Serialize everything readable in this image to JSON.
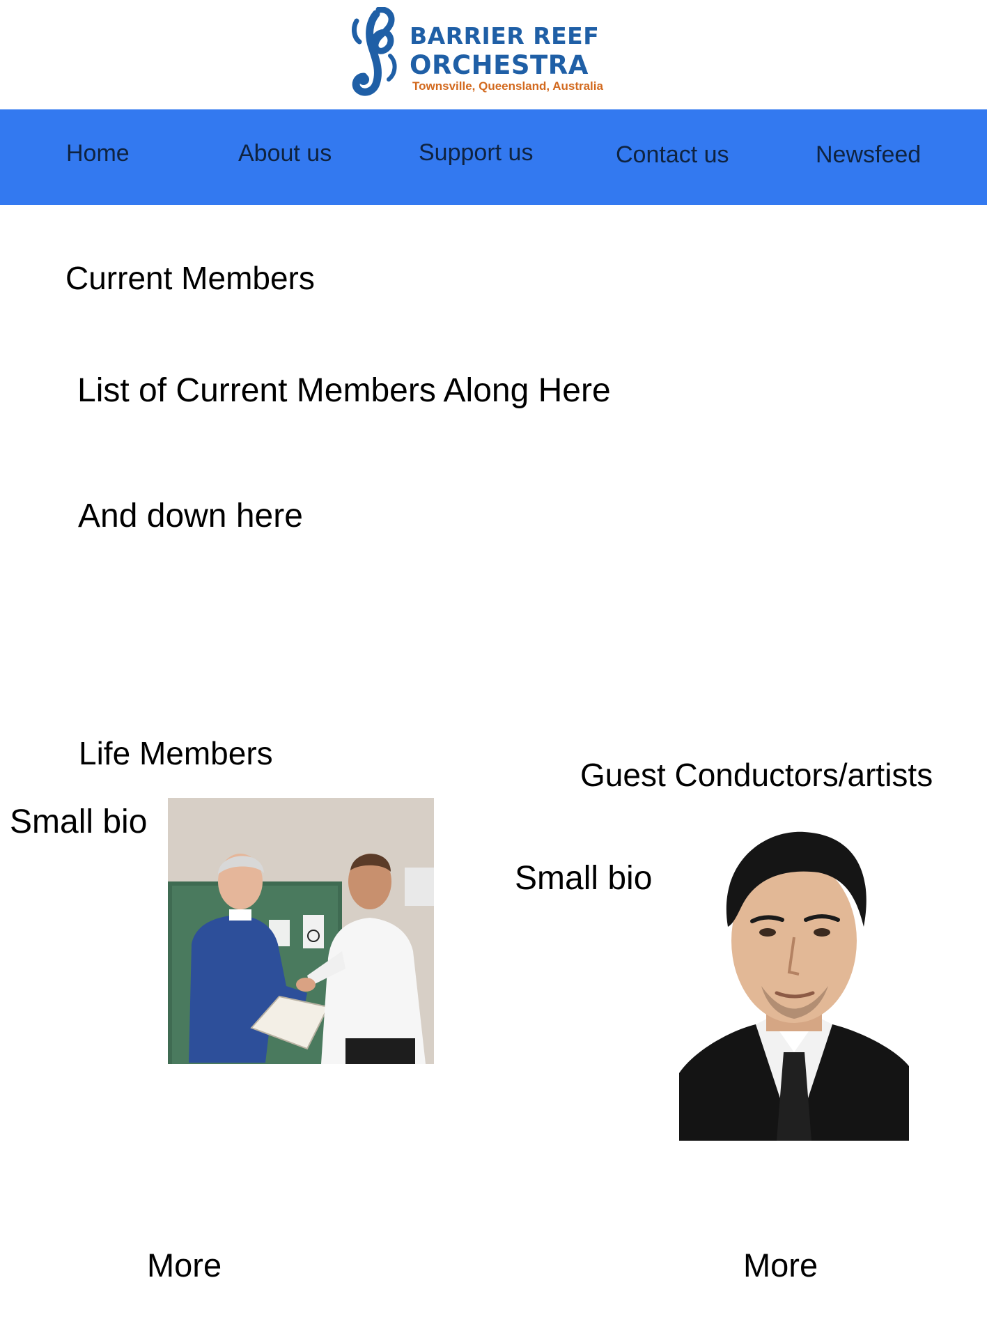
{
  "logo": {
    "line1": "BARRIER REEF",
    "line2": "ORCHESTRA",
    "tagline": "Townsville, Queensland, Australia",
    "icon": "treble-clef-seahorse-icon",
    "colors": {
      "primary": "#1f5fa6",
      "tagline": "#d2691e"
    }
  },
  "nav": {
    "background": "#3379f0",
    "items": [
      {
        "label": "Home"
      },
      {
        "label": "About us"
      },
      {
        "label": "Support us"
      },
      {
        "label": "Contact us"
      },
      {
        "label": "Newsfeed"
      }
    ]
  },
  "current_members": {
    "heading": "Current Members",
    "line1": "List of Current Members Along Here",
    "line2": "And down here"
  },
  "life_members": {
    "heading": "Life Members",
    "bio": "Small bio",
    "more": "More"
  },
  "guests": {
    "heading": "Guest Conductors/artists",
    "bio": "Small bio",
    "more": "More"
  }
}
